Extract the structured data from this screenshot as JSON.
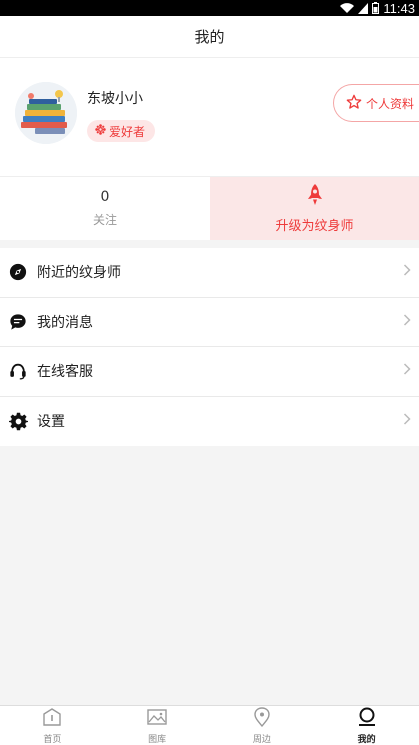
{
  "status_bar": {
    "time": "11:43"
  },
  "header": {
    "title": "我的"
  },
  "profile": {
    "username": "东坡小小",
    "badge": "爱好者",
    "profile_button": "个人资料"
  },
  "stats": {
    "follow_count": "0",
    "follow_label": "关注",
    "upgrade_label": "升级为纹身师"
  },
  "menu": {
    "items": [
      {
        "label": "附近的纹身师",
        "icon": "compass-icon"
      },
      {
        "label": "我的消息",
        "icon": "message-icon"
      },
      {
        "label": "在线客服",
        "icon": "headset-icon"
      },
      {
        "label": "设置",
        "icon": "gear-icon"
      }
    ]
  },
  "tabs": [
    {
      "label": "首页",
      "icon": "home-icon"
    },
    {
      "label": "图库",
      "icon": "gallery-icon"
    },
    {
      "label": "周边",
      "icon": "location-icon"
    },
    {
      "label": "我的",
      "icon": "user-icon",
      "active": true
    }
  ],
  "colors": {
    "accent": "#ee3b3b",
    "upgrade_bg": "#fbe7e7",
    "badge_bg": "#fde6e6"
  }
}
